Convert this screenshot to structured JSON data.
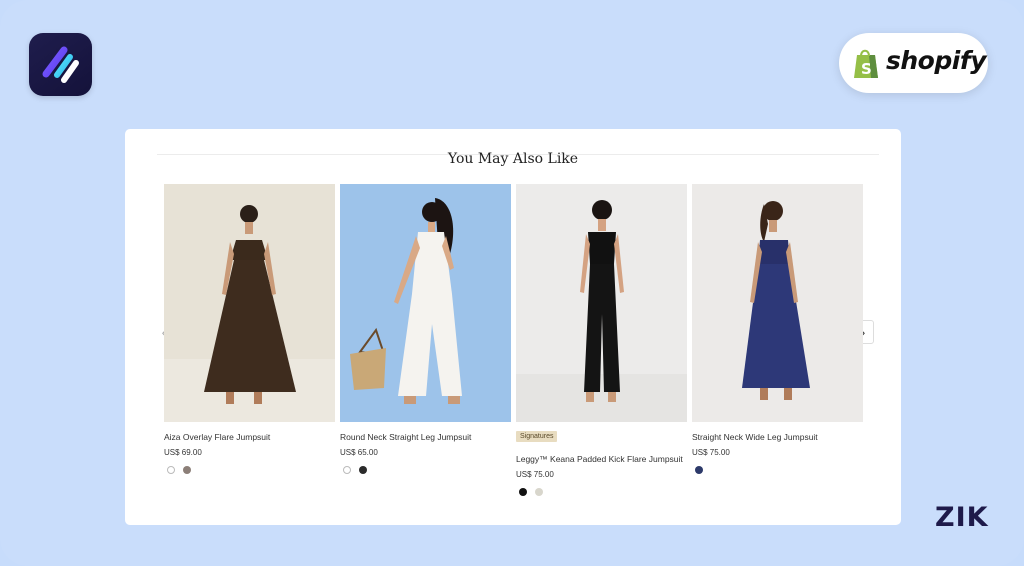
{
  "section": {
    "title": "You May Also Like"
  },
  "brand": {
    "platform": "shopify",
    "watermark": "ZIK"
  },
  "carousel": {
    "prev_icon": "‹",
    "next_icon": "›"
  },
  "products": [
    {
      "name": "Aiza Overlay Flare Jumpsuit",
      "price": "US$ 69.00",
      "badge": "",
      "swatches": [
        "#ffffff",
        "#8c7f78"
      ]
    },
    {
      "name": "Round Neck Straight Leg Jumpsuit",
      "price": "US$ 65.00",
      "badge": "",
      "swatches": [
        "#ffffff",
        "#2b2b2b"
      ]
    },
    {
      "name": "Leggy™ Keana Padded Kick Flare Jumpsuit",
      "price": "US$ 75.00",
      "badge": "Signatures",
      "swatches": [
        "#111111",
        "#d8d6cc"
      ]
    },
    {
      "name": "Straight Neck Wide Leg Jumpsuit",
      "price": "US$ 75.00",
      "badge": "",
      "swatches": [
        "#2d3a6a"
      ]
    }
  ],
  "colors": {
    "background": "#c9ddfb",
    "panel": "#ffffff",
    "shopify_green": "#95bf47",
    "logo_bg": "#1f1d4d"
  }
}
